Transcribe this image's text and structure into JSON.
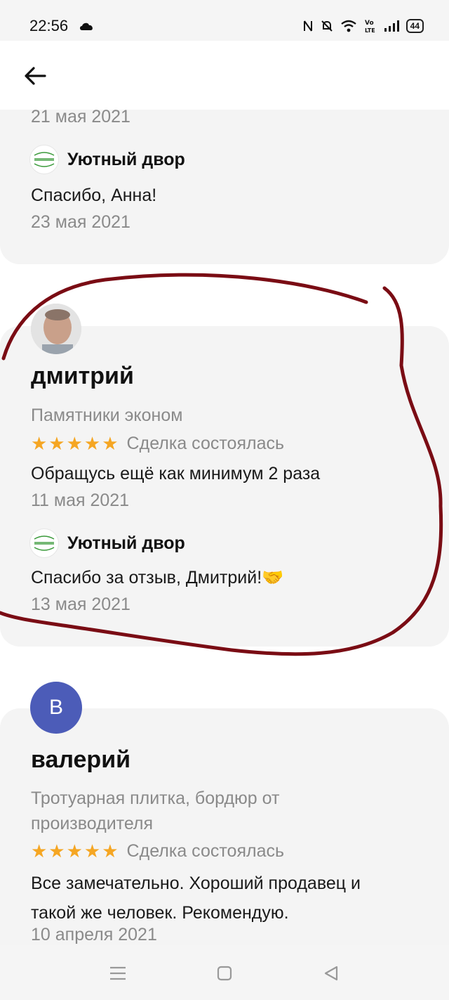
{
  "status_bar": {
    "time": "22:56",
    "battery": "44",
    "icons": [
      "cloud-icon",
      "nfc-icon",
      "mute-icon",
      "wifi-icon",
      "volte-icon",
      "signal-icon",
      "battery-icon"
    ]
  },
  "header": {
    "back_icon": "arrow-left-icon"
  },
  "reviews": [
    {
      "date": "21 мая 2021",
      "reply": {
        "seller": "Уютный двор",
        "text": "Спасибо, Анна!",
        "date": "23 мая 2021"
      }
    },
    {
      "author": "дмитрий",
      "product": "Памятники эконом",
      "stars": "★★★★★",
      "rating": 5,
      "deal_status": "Сделка состоялась",
      "text": "Обращусь ещё как минимум 2 раза",
      "date": "11 мая 2021",
      "reply": {
        "seller": "Уютный двор",
        "text": "Спасибо за отзыв, Дмитрий!🤝",
        "date": "13 мая 2021"
      }
    },
    {
      "author": "валерий",
      "avatar_letter": "В",
      "product_line1": "Тротуарная плитка, бордюр от",
      "product_line2": "производителя",
      "stars": "★★★★★",
      "rating": 5,
      "deal_status": "Сделка состоялась",
      "text_line1": "Все замечательно. Хороший продавец и",
      "text_line2": "такой же человек. Рекомендую.",
      "date": "10 апреля 2021"
    }
  ],
  "nav": {
    "icons": [
      "menu-icon",
      "home-square-icon",
      "back-triangle-icon"
    ]
  },
  "colors": {
    "stars": "#f5a623",
    "avatar": "#4c5cb8",
    "annotation": "#7a0c14",
    "card_bg": "#f4f4f4"
  }
}
